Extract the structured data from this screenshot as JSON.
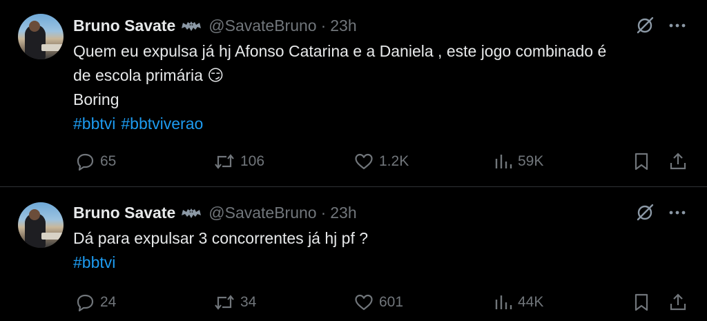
{
  "tweets": [
    {
      "author": {
        "name": "Bruno Savate",
        "handle": "@SavateBruno",
        "time": "23h",
        "badge_icon": "bat-emoji-icon"
      },
      "text_lines": [
        "Quem eu expulsa já hj Afonso Catarina e a Daniela , este jogo combinado  é",
        "de escola primária 😏",
        "Boring"
      ],
      "hashtags": [
        "#bbtvi",
        "#bbtviverao"
      ],
      "stats": {
        "replies": "65",
        "retweets": "106",
        "likes": "1.2K",
        "views": "59K"
      }
    },
    {
      "author": {
        "name": "Bruno Savate",
        "handle": "@SavateBruno",
        "time": "23h",
        "badge_icon": "bat-emoji-icon"
      },
      "text_lines": [
        "Dá para expulsar 3 concorrentes já hj pf ?"
      ],
      "hashtags": [
        "#bbtvi"
      ],
      "stats": {
        "replies": "24",
        "retweets": "34",
        "likes": "601",
        "views": "44K"
      }
    }
  ],
  "separator": "·",
  "colors": {
    "background": "#000000",
    "text": "#e7e9ea",
    "muted": "#71767b",
    "link": "#1d9bf0",
    "divider": "#2f3336"
  }
}
